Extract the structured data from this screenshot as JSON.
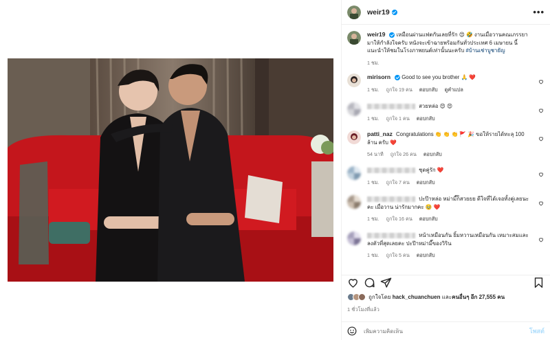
{
  "post": {
    "username": "weir19",
    "caption": "เหมือนผ่านแฟตกันเลยที่รัก 😍 🤣 งานเมื่อวานคณเภรรยามาให้กำลังใจครับ หนังจะเข้าฉายพร้อมกันทั่วประเทศ 6 เมษายน นี้ แนะนำให้ชมในโรงภาพยนต์เท่านั้นนะครับ",
    "hashtag": "#บ้านเช่าบูชายัญ",
    "caption_time": "1 ชม."
  },
  "comments": [
    {
      "username": "mirisorn",
      "verified": true,
      "text": "Good to see you brother 🙏 ❤️",
      "time": "1 ชม.",
      "likes": "ถูกใจ 19 คน",
      "reply": "ตอบกลับ",
      "translate": "ดูคำแปล",
      "blurred": false
    },
    {
      "username": "",
      "verified": false,
      "text": "สวยหล่อ 😍 😍",
      "time": "1 ชม.",
      "likes": "ถูกใจ 1 คน",
      "reply": "ตอบกลับ",
      "translate": "",
      "blurred": true
    },
    {
      "username": "patti_naz",
      "verified": false,
      "text": "Congratulations 👏 👏 👏 🚩 🎉 ขอให้รายได้ทะลุ 100 ล้าน ครับ ❤️",
      "time": "54 นาที",
      "likes": "ถูกใจ 26 คน",
      "reply": "ตอบกลับ",
      "translate": "",
      "blurred": false
    },
    {
      "username": "",
      "verified": false,
      "text": "ชุดคู่รัก ❤️",
      "time": "1 ชม.",
      "likes": "ถูกใจ 7 คน",
      "reply": "ตอบกลับ",
      "translate": "",
      "blurred": true
    },
    {
      "username": "",
      "verified": false,
      "text": "ปะป๊าหล่อ หม่ามี๊ก็สวยยย ดีใจที่ได้เจอทั้งคู่เลยนะคะ เมื่อวาน น่ารักมากคะ 🥹 ❤️",
      "time": "1 ชม.",
      "likes": "ถูกใจ 16 คน",
      "reply": "ตอบกลับ",
      "translate": "",
      "blurred": true
    },
    {
      "username": "",
      "verified": false,
      "text": "หน้าเหมือนกัน ยิ้มหวานเหมือนกัน เหมาะสมและลงตัวที่สุดเลยคะ ปะป๊าหม่ามี๊ของวิริน",
      "time": "1 ชม.",
      "likes": "ถูกใจ 5 คน",
      "reply": "ตอบกลับ",
      "translate": "",
      "blurred": true
    }
  ],
  "likes": {
    "prefix": "ถูกใจโดย",
    "user": "hack_chuanchuen",
    "middle": "และ",
    "others": "คนอื่นๆ อีก 27,555 คน"
  },
  "post_time": "1 ชั่วโมงที่แล้ว",
  "add_comment": {
    "placeholder": "เพิ่มความคิดเห็น",
    "post_label": "โพสต์"
  },
  "icons": [
    "more-icon",
    "heart-icon",
    "comment-icon",
    "share-icon",
    "bookmark-icon",
    "emoji-icon"
  ],
  "colors": {
    "verified": "#0095f6",
    "link": "#00376b",
    "meta": "#737373",
    "post_button": "#b2dffc"
  }
}
